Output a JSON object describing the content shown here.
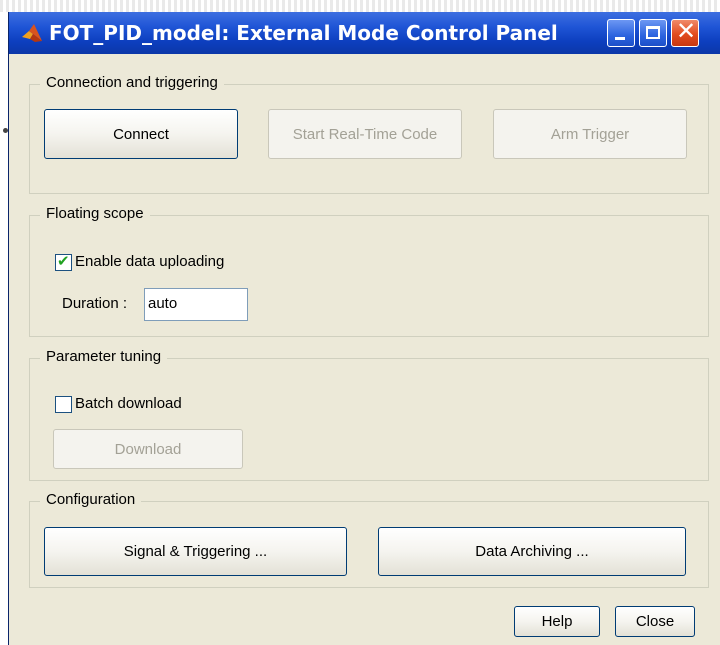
{
  "window": {
    "title": "FOT_PID_model: External Mode Control Panel",
    "title_controls": {
      "minimize_icon": "minimize-icon",
      "maximize_icon": "maximize-icon",
      "close_glyph": "✕"
    },
    "colors": {
      "titlebar": "#0d3fbf",
      "face": "#ece9d8",
      "close": "#e24c1f",
      "check": "#21a121"
    }
  },
  "connection": {
    "group_label": "Connection and triggering",
    "connect_label": "Connect",
    "start_label": "Start Real-Time Code",
    "arm_label": "Arm Trigger"
  },
  "floating_scope": {
    "group_label": "Floating scope",
    "enable_upload_label": "Enable data uploading",
    "enable_upload_checked": true,
    "duration_label": "Duration :",
    "duration_value": "auto"
  },
  "parameter_tuning": {
    "group_label": "Parameter tuning",
    "batch_label": "Batch download",
    "batch_checked": false,
    "download_label": "Download"
  },
  "configuration": {
    "group_label": "Configuration",
    "signal_label": "Signal & Triggering ...",
    "archiving_label": "Data Archiving ..."
  },
  "footer": {
    "help_label": "Help",
    "close_label": "Close"
  }
}
